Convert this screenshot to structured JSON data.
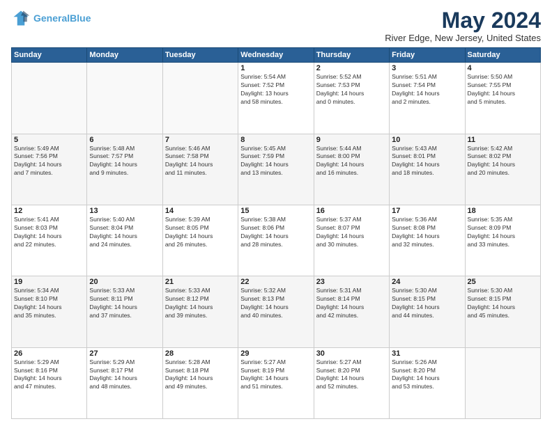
{
  "header": {
    "logo_line1": "General",
    "logo_line2": "Blue",
    "title": "May 2024",
    "location": "River Edge, New Jersey, United States"
  },
  "weekdays": [
    "Sunday",
    "Monday",
    "Tuesday",
    "Wednesday",
    "Thursday",
    "Friday",
    "Saturday"
  ],
  "weeks": [
    [
      {
        "day": "",
        "info": ""
      },
      {
        "day": "",
        "info": ""
      },
      {
        "day": "",
        "info": ""
      },
      {
        "day": "1",
        "info": "Sunrise: 5:54 AM\nSunset: 7:52 PM\nDaylight: 13 hours\nand 58 minutes."
      },
      {
        "day": "2",
        "info": "Sunrise: 5:52 AM\nSunset: 7:53 PM\nDaylight: 14 hours\nand 0 minutes."
      },
      {
        "day": "3",
        "info": "Sunrise: 5:51 AM\nSunset: 7:54 PM\nDaylight: 14 hours\nand 2 minutes."
      },
      {
        "day": "4",
        "info": "Sunrise: 5:50 AM\nSunset: 7:55 PM\nDaylight: 14 hours\nand 5 minutes."
      }
    ],
    [
      {
        "day": "5",
        "info": "Sunrise: 5:49 AM\nSunset: 7:56 PM\nDaylight: 14 hours\nand 7 minutes."
      },
      {
        "day": "6",
        "info": "Sunrise: 5:48 AM\nSunset: 7:57 PM\nDaylight: 14 hours\nand 9 minutes."
      },
      {
        "day": "7",
        "info": "Sunrise: 5:46 AM\nSunset: 7:58 PM\nDaylight: 14 hours\nand 11 minutes."
      },
      {
        "day": "8",
        "info": "Sunrise: 5:45 AM\nSunset: 7:59 PM\nDaylight: 14 hours\nand 13 minutes."
      },
      {
        "day": "9",
        "info": "Sunrise: 5:44 AM\nSunset: 8:00 PM\nDaylight: 14 hours\nand 16 minutes."
      },
      {
        "day": "10",
        "info": "Sunrise: 5:43 AM\nSunset: 8:01 PM\nDaylight: 14 hours\nand 18 minutes."
      },
      {
        "day": "11",
        "info": "Sunrise: 5:42 AM\nSunset: 8:02 PM\nDaylight: 14 hours\nand 20 minutes."
      }
    ],
    [
      {
        "day": "12",
        "info": "Sunrise: 5:41 AM\nSunset: 8:03 PM\nDaylight: 14 hours\nand 22 minutes."
      },
      {
        "day": "13",
        "info": "Sunrise: 5:40 AM\nSunset: 8:04 PM\nDaylight: 14 hours\nand 24 minutes."
      },
      {
        "day": "14",
        "info": "Sunrise: 5:39 AM\nSunset: 8:05 PM\nDaylight: 14 hours\nand 26 minutes."
      },
      {
        "day": "15",
        "info": "Sunrise: 5:38 AM\nSunset: 8:06 PM\nDaylight: 14 hours\nand 28 minutes."
      },
      {
        "day": "16",
        "info": "Sunrise: 5:37 AM\nSunset: 8:07 PM\nDaylight: 14 hours\nand 30 minutes."
      },
      {
        "day": "17",
        "info": "Sunrise: 5:36 AM\nSunset: 8:08 PM\nDaylight: 14 hours\nand 32 minutes."
      },
      {
        "day": "18",
        "info": "Sunrise: 5:35 AM\nSunset: 8:09 PM\nDaylight: 14 hours\nand 33 minutes."
      }
    ],
    [
      {
        "day": "19",
        "info": "Sunrise: 5:34 AM\nSunset: 8:10 PM\nDaylight: 14 hours\nand 35 minutes."
      },
      {
        "day": "20",
        "info": "Sunrise: 5:33 AM\nSunset: 8:11 PM\nDaylight: 14 hours\nand 37 minutes."
      },
      {
        "day": "21",
        "info": "Sunrise: 5:33 AM\nSunset: 8:12 PM\nDaylight: 14 hours\nand 39 minutes."
      },
      {
        "day": "22",
        "info": "Sunrise: 5:32 AM\nSunset: 8:13 PM\nDaylight: 14 hours\nand 40 minutes."
      },
      {
        "day": "23",
        "info": "Sunrise: 5:31 AM\nSunset: 8:14 PM\nDaylight: 14 hours\nand 42 minutes."
      },
      {
        "day": "24",
        "info": "Sunrise: 5:30 AM\nSunset: 8:15 PM\nDaylight: 14 hours\nand 44 minutes."
      },
      {
        "day": "25",
        "info": "Sunrise: 5:30 AM\nSunset: 8:15 PM\nDaylight: 14 hours\nand 45 minutes."
      }
    ],
    [
      {
        "day": "26",
        "info": "Sunrise: 5:29 AM\nSunset: 8:16 PM\nDaylight: 14 hours\nand 47 minutes."
      },
      {
        "day": "27",
        "info": "Sunrise: 5:29 AM\nSunset: 8:17 PM\nDaylight: 14 hours\nand 48 minutes."
      },
      {
        "day": "28",
        "info": "Sunrise: 5:28 AM\nSunset: 8:18 PM\nDaylight: 14 hours\nand 49 minutes."
      },
      {
        "day": "29",
        "info": "Sunrise: 5:27 AM\nSunset: 8:19 PM\nDaylight: 14 hours\nand 51 minutes."
      },
      {
        "day": "30",
        "info": "Sunrise: 5:27 AM\nSunset: 8:20 PM\nDaylight: 14 hours\nand 52 minutes."
      },
      {
        "day": "31",
        "info": "Sunrise: 5:26 AM\nSunset: 8:20 PM\nDaylight: 14 hours\nand 53 minutes."
      },
      {
        "day": "",
        "info": ""
      }
    ]
  ]
}
